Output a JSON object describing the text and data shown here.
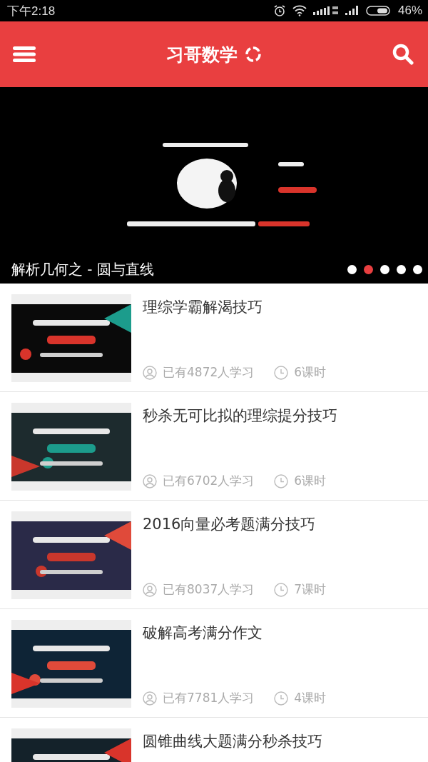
{
  "status_bar": {
    "time": "下午2:18",
    "battery": "46%"
  },
  "header": {
    "title": "习哥数学"
  },
  "banner": {
    "caption": "解析几何之 - 圆与直线",
    "dots": [
      {
        "selected": false
      },
      {
        "selected": true
      },
      {
        "selected": false
      },
      {
        "selected": false
      },
      {
        "selected": false
      }
    ]
  },
  "courses": [
    {
      "title": "理综学霸解渴技巧",
      "learners": "已有4872人学习",
      "lessons": "6课时"
    },
    {
      "title": "秒杀无可比拟的理综提分技巧",
      "learners": "已有6702人学习",
      "lessons": "6课时"
    },
    {
      "title": "2016向量必考题满分技巧",
      "learners": "已有8037人学习",
      "lessons": "7课时"
    },
    {
      "title": "破解高考满分作文",
      "learners": "已有7781人学习",
      "lessons": "4课时"
    },
    {
      "title": "圆锥曲线大题满分秒杀技巧"
    }
  ]
}
